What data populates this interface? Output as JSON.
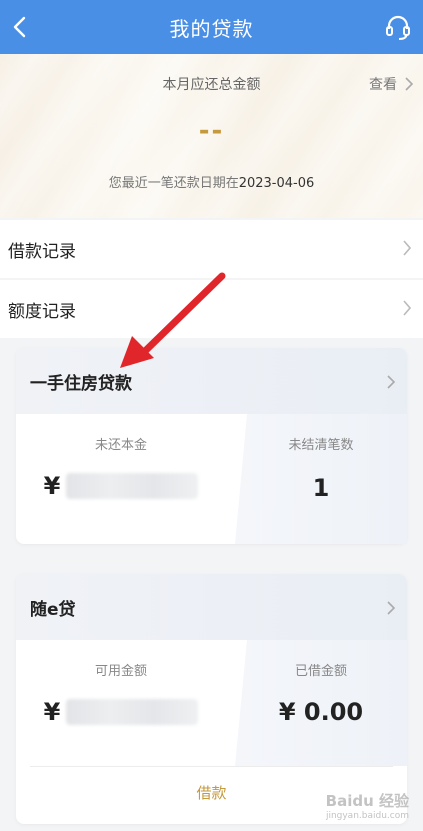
{
  "header": {
    "title": "我的贷款",
    "back_icon": "chevron-left-icon",
    "support_icon": "headset-icon",
    "bg_color": "#4a8fe6"
  },
  "repayment": {
    "title": "本月应还总金额",
    "view_label": "查看",
    "amount": "--",
    "date_prefix": "您最近一笔还款日期在",
    "date_value": "2023-04-06",
    "amount_color": "#c49a3c"
  },
  "menu": {
    "loan_records": "借款记录",
    "credit_records": "额度记录"
  },
  "cards": [
    {
      "title": "一手住房贷款",
      "left_label": "未还本金",
      "left_prefix": "¥",
      "right_label": "未结清笔数",
      "right_value": "1"
    },
    {
      "title": "随e贷",
      "left_label": "可用金额",
      "left_prefix": "¥",
      "right_label": "已借金额",
      "right_value": "¥ 0.00",
      "action_label": "借款"
    }
  ],
  "annotation": {
    "arrow_color": "#e1262b"
  },
  "watermark": {
    "text": "Baidu 经验",
    "sub": "jingyan.baidu.com"
  }
}
